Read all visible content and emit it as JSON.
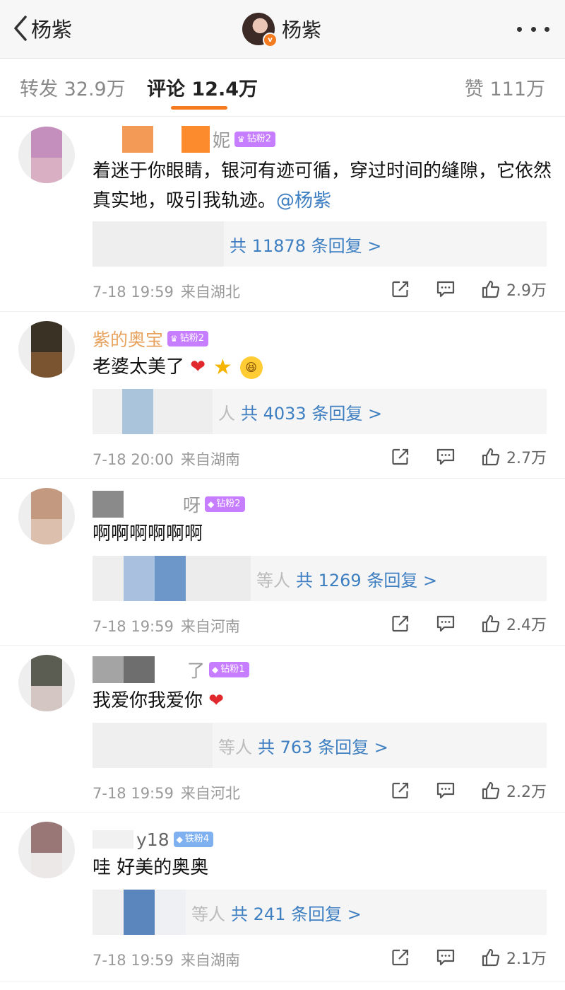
{
  "header": {
    "back_label": "杨紫",
    "title": "杨紫",
    "more_icon": "more-dots-icon"
  },
  "tabs": {
    "repost": "转发 32.9万",
    "comment": "评论 12.4万",
    "like": "赞 111万"
  },
  "colors": {
    "accent": "#f47b20",
    "link": "#3e7fc1",
    "meta": "#999999",
    "badge_purple": "#c77dff",
    "badge_blue": "#7fb0f0"
  },
  "comments": [
    {
      "username": "妮",
      "badge": "钻粉2",
      "text": "着迷于你眼睛，银河有迹可循，穿过时间的缝隙，它依然真实地，吸引我轨迹。",
      "mention": "@杨紫",
      "reply_prefix": "",
      "reply_count": "共 11878 条回复 >",
      "date": "7-18 19:59",
      "location": "来自湖北",
      "likes": "2.9万"
    },
    {
      "username": "紫的奥宝",
      "badge": "钻粉2",
      "text": "老婆太美了",
      "reply_prefix": "人",
      "reply_count": "共 4033 条回复 >",
      "date": "7-18 20:00",
      "location": "来自湖南",
      "likes": "2.7万"
    },
    {
      "username": "呀",
      "badge": "钻粉2",
      "text": "啊啊啊啊啊啊",
      "reply_prefix": "等人",
      "reply_count": "共 1269 条回复 >",
      "date": "7-18 19:59",
      "location": "来自河南",
      "likes": "2.4万"
    },
    {
      "username": "了",
      "badge": "钻粉1",
      "text": "我爱你我爱你",
      "reply_prefix": "等人",
      "reply_count": "共 763 条回复 >",
      "date": "7-18 19:59",
      "location": "来自河北",
      "likes": "2.2万"
    },
    {
      "username": "y18",
      "badge": "铁粉4",
      "text": "哇 好美的奥奥",
      "reply_prefix": "等人",
      "reply_count": "共 241 条回复 >",
      "date": "7-18 19:59",
      "location": "来自湖南",
      "likes": "2.1万"
    }
  ]
}
